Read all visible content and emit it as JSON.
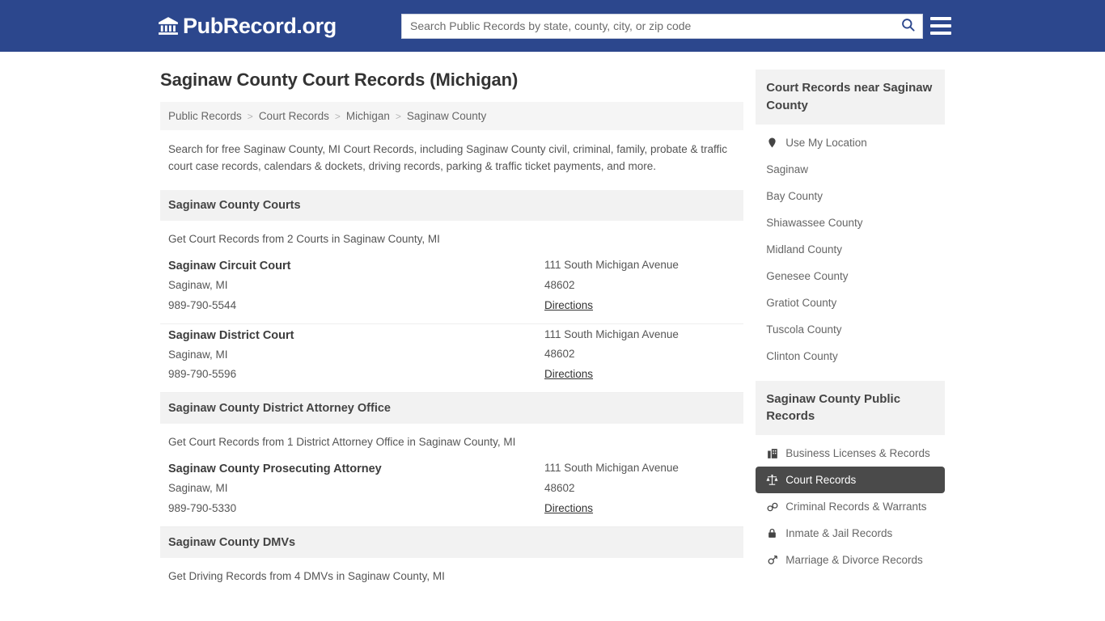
{
  "header": {
    "logo_text": "PubRecord.org",
    "logo_icon": "bank-building-icon",
    "search_placeholder": "Search Public Records by state, county, city, or zip code",
    "search_value": "",
    "search_icon": "search-icon",
    "menu_icon": "hamburger-menu-icon",
    "brand_color": "#2c478d"
  },
  "page": {
    "title": "Saginaw County Court Records (Michigan)",
    "intro": "Search for free Saginaw County, MI Court Records, including Saginaw County civil, criminal, family, probate & traffic court case records, calendars & dockets, driving records, parking & traffic ticket payments, and more."
  },
  "breadcrumb": {
    "separator": ">",
    "items": [
      {
        "label": "Public Records"
      },
      {
        "label": "Court Records"
      },
      {
        "label": "Michigan"
      },
      {
        "label": "Saginaw County"
      }
    ]
  },
  "sections": [
    {
      "header": "Saginaw County Courts",
      "subtitle": "Get Court Records from 2 Courts in Saginaw County, MI",
      "listings": [
        {
          "name": "Saginaw Circuit Court",
          "city_state": "Saginaw, MI",
          "phone": "989-790-5544",
          "address": "111 South Michigan Avenue",
          "zip": "48602",
          "directions": "Directions"
        },
        {
          "name": "Saginaw District Court",
          "city_state": "Saginaw, MI",
          "phone": "989-790-5596",
          "address": "111 South Michigan Avenue",
          "zip": "48602",
          "directions": "Directions"
        }
      ]
    },
    {
      "header": "Saginaw County District Attorney Office",
      "subtitle": "Get Court Records from 1 District Attorney Office in Saginaw County, MI",
      "listings": [
        {
          "name": "Saginaw County Prosecuting Attorney",
          "city_state": "Saginaw, MI",
          "phone": "989-790-5330",
          "address": "111 South Michigan Avenue",
          "zip": "48602",
          "directions": "Directions"
        }
      ]
    },
    {
      "header": "Saginaw County DMVs",
      "subtitle": "Get Driving Records from 4 DMVs in Saginaw County, MI",
      "listings": []
    }
  ],
  "sidebar": {
    "nearby": {
      "header": "Court Records near Saginaw County",
      "items": [
        {
          "label": "Use My Location",
          "icon": "map-pin-icon"
        },
        {
          "label": "Saginaw",
          "icon": ""
        },
        {
          "label": "Bay County",
          "icon": ""
        },
        {
          "label": "Shiawassee County",
          "icon": ""
        },
        {
          "label": "Midland County",
          "icon": ""
        },
        {
          "label": "Genesee County",
          "icon": ""
        },
        {
          "label": "Gratiot County",
          "icon": ""
        },
        {
          "label": "Tuscola County",
          "icon": ""
        },
        {
          "label": "Clinton County",
          "icon": ""
        }
      ]
    },
    "public_records": {
      "header": "Saginaw County Public Records",
      "active_label": "Court Records",
      "active_color": "#4a4a4a",
      "items": [
        {
          "label": "Business Licenses & Records",
          "icon": "business-building-icon",
          "active": false
        },
        {
          "label": "Court Records",
          "icon": "scales-of-justice-icon",
          "active": true
        },
        {
          "label": "Criminal Records & Warrants",
          "icon": "handcuffs-icon",
          "active": false
        },
        {
          "label": "Inmate & Jail Records",
          "icon": "lock-icon",
          "active": false
        },
        {
          "label": "Marriage & Divorce Records",
          "icon": "gender-symbols-icon",
          "active": false
        }
      ]
    }
  }
}
